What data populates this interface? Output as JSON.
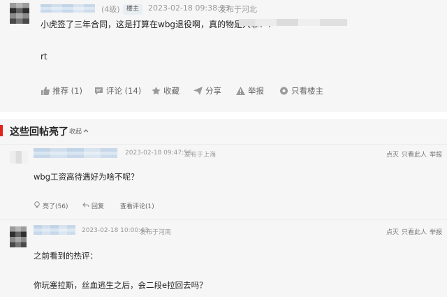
{
  "main_post": {
    "level": "(4级)",
    "badge": "楼主",
    "time": "2023-02-18 09:38:23",
    "location": "发布于河北",
    "body": "小虎签了三年合同，这是打算在wbg退役啊，真的物是人非！！",
    "body2": "rt",
    "actions": [
      {
        "label": "推荐 (1)",
        "icon": "thumbs-up-icon"
      },
      {
        "label": "评论 (14)",
        "icon": "comment-icon"
      },
      {
        "label": "收藏",
        "icon": "star-icon"
      },
      {
        "label": "分享",
        "icon": "share-icon"
      },
      {
        "label": "举报",
        "icon": "warning-icon"
      },
      {
        "label": "只看楼主",
        "icon": "eye-icon"
      }
    ]
  },
  "section": {
    "title": "这些回帖亮了",
    "collapse": "收起",
    "accent_color": "#e2231a"
  },
  "replies": [
    {
      "time": "2023-02-18 09:47:56",
      "location": "发布于上海",
      "right_actions": [
        "点灭",
        "只看此人",
        "举报"
      ],
      "body": "wbg工资高待遇好为啥不呢？",
      "actions": [
        "亮了(56)",
        "回复",
        "查看评论(1)"
      ]
    },
    {
      "time": "2023-02-18 10:00:43",
      "location": "发布于河南",
      "right_actions": [
        "点灭",
        "只看此人",
        "举报"
      ],
      "body": "之前看到的热评：",
      "body2": "你玩塞拉斯，丝血逃生之后，会二段e拉回去吗？"
    }
  ]
}
